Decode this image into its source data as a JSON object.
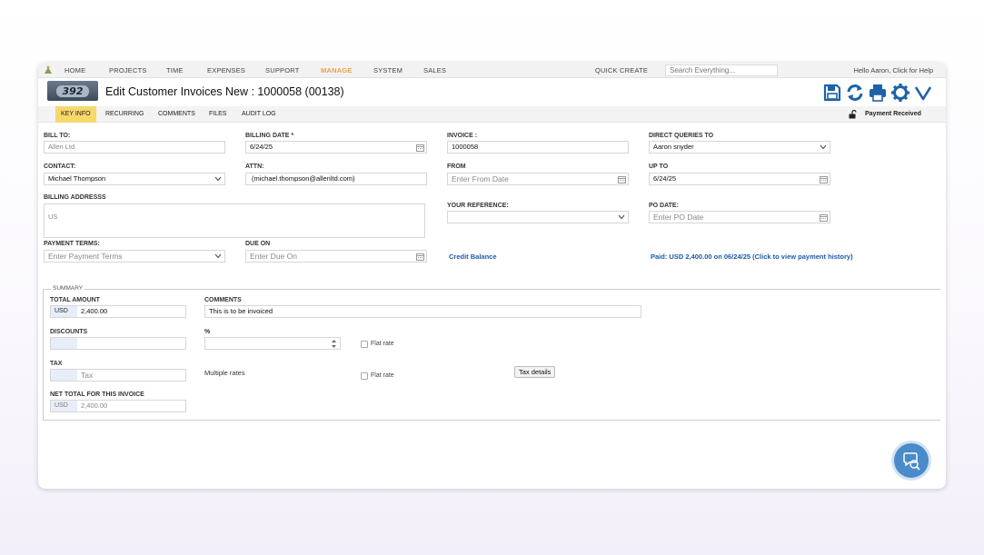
{
  "topnav": {
    "items": [
      "HOME",
      "PROJECTS",
      "TIME",
      "EXPENSES",
      "SUPPORT",
      "MANAGE",
      "SYSTEM",
      "SALES"
    ],
    "active_item": "MANAGE",
    "quick_create": "QUICK CREATE",
    "search_placeholder": "Search Everything...",
    "greeting": "Hello Aaron, Click for Help"
  },
  "header": {
    "badge_text": "392",
    "title": "Edit Customer Invoices New : 1000058 (00138)",
    "tool_icons": [
      "save-icon",
      "refresh-icon",
      "print-icon",
      "settings-icon",
      "chevron-down-icon"
    ]
  },
  "subtabs": {
    "items": [
      "KEY INFO",
      "RECURRING",
      "COMMENTS",
      "FILES",
      "AUDIT LOG"
    ],
    "active": "KEY INFO",
    "status": "Payment Received"
  },
  "form": {
    "bill_to": {
      "label": "BILL TO:",
      "value": "Allen Ltd"
    },
    "billing_date": {
      "label": "BILLING DATE *",
      "value": "6/24/25"
    },
    "invoice": {
      "label": "INVOICE :",
      "value": "1000058"
    },
    "direct_queries": {
      "label": "DIRECT QUERIES TO",
      "value": "Aaron snyder"
    },
    "contact": {
      "label": "CONTACT:",
      "value": "Michael Thompson"
    },
    "attn": {
      "label": "ATTN:",
      "value": "(michael.thompson@allenltd.com)"
    },
    "from": {
      "label": "FROM",
      "placeholder": "Enter From Date"
    },
    "up_to": {
      "label": "UP TO",
      "value": "6/24/25"
    },
    "billing_address": {
      "label": "BILLING ADDRESSS",
      "value": "US"
    },
    "your_reference": {
      "label": "YOUR REFERENCE:",
      "value": ""
    },
    "po_date": {
      "label": "PO DATE:",
      "placeholder": "Enter PO Date"
    },
    "payment_terms": {
      "label": "PAYMENT TERMS:",
      "placeholder": "Enter Payment Terms"
    },
    "due_on": {
      "label": "DUE ON",
      "placeholder": "Enter Due On"
    },
    "credit_balance_link": "Credit Balance",
    "paid_link": "Paid: USD 2,400.00 on 06/24/25 (Click to view payment history)"
  },
  "summary": {
    "legend": "SUMMARY",
    "total_amount": {
      "label": "TOTAL AMOUNT",
      "currency": "USD",
      "value": "2,400.00"
    },
    "comments": {
      "label": "COMMENTS",
      "value": "This is to be invoiced"
    },
    "discounts": {
      "label": "DISCOUNTS",
      "value": ""
    },
    "percent": {
      "label": "%",
      "value": ""
    },
    "flat_rate_1": "Flat rate",
    "tax": {
      "label": "TAX",
      "placeholder": "Tax"
    },
    "multiple_rates": "Multiple rates",
    "flat_rate_2": "Flat rate",
    "tax_details_button": "Tax details",
    "net_total": {
      "label": "NET TOTAL FOR THIS INVOICE",
      "currency": "USD",
      "value": "2,400.00"
    }
  },
  "colors": {
    "accent_nav": "#f0a050",
    "active_tab": "#f7d86b",
    "link": "#1b5aa8",
    "toolbar_icon": "#1e62a8",
    "chat_button": "#4a8bc9"
  }
}
